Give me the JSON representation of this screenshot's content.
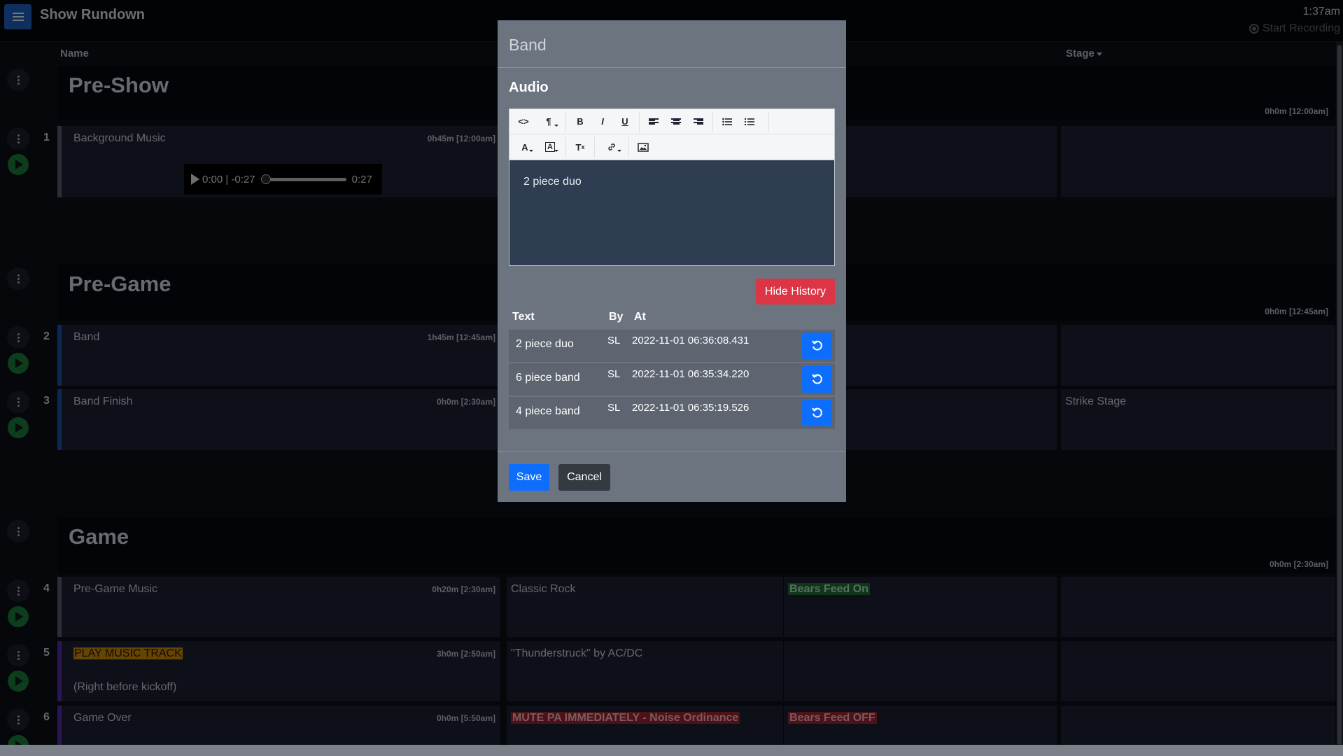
{
  "app": {
    "title": "Show Rundown",
    "clock": "1:37am",
    "recording": "Start Recording"
  },
  "columns": {
    "name": "Name",
    "stage": "Stage"
  },
  "sections": [
    {
      "title": "Pre-Show",
      "time": "0h0m  [12:00am]"
    },
    {
      "title": "Pre-Game",
      "time": "0h0m  [12:45am]"
    },
    {
      "title": "Game",
      "time": "0h0m  [2:30am]"
    }
  ],
  "rows": [
    {
      "num": "1",
      "name": "Background Music",
      "dur": "0h45m  [12:00am]"
    },
    {
      "num": "2",
      "name": "Band",
      "dur": "1h45m  [12:45am]"
    },
    {
      "num": "3",
      "name": "Band Finish",
      "dur": "0h0m  [2:30am]",
      "stage": "Strike Stage"
    },
    {
      "num": "4",
      "name": "Pre-Game Music",
      "dur": "0h20m  [2:30am]",
      "audio": "Classic Rock",
      "video": "Bears Feed On"
    },
    {
      "num": "5",
      "name": "PLAY MUSIC TRACK",
      "note": "(Right before kickoff)",
      "dur": "3h0m  [2:50am]",
      "audio": "\"Thunderstruck\" by AC/DC"
    },
    {
      "num": "6",
      "name": "Game Over",
      "dur": "0h0m  [5:50am]",
      "audio": "MUTE PA IMMEDIATELY - Noise Ordinance",
      "video": "Bears Feed OFF"
    }
  ],
  "player": {
    "current": "0:00",
    "remaining": "-0:27",
    "total": "0:27",
    "progress": 0
  },
  "modal": {
    "title": "Band",
    "field_label": "Audio",
    "editor_value": "2 piece duo",
    "hide_history": "Hide History",
    "history_headers": {
      "text": "Text",
      "by": "By",
      "at": "At"
    },
    "history": [
      {
        "text": "2 piece duo",
        "by": "SL",
        "at": "2022-11-01 06:36:08.431"
      },
      {
        "text": "6 piece band",
        "by": "SL",
        "at": "2022-11-01 06:35:34.220"
      },
      {
        "text": "4 piece band",
        "by": "SL",
        "at": "2022-11-01 06:35:19.526"
      }
    ],
    "save": "Save",
    "cancel": "Cancel"
  },
  "toolbar_icons": [
    "code-view-icon",
    "paragraph-icon",
    "bold-icon",
    "italic-icon",
    "underline-icon",
    "align-left-icon",
    "align-center-icon",
    "align-right-icon",
    "bullet-list-icon",
    "numbered-list-icon",
    "font-color-icon",
    "highlight-color-icon",
    "clear-format-icon",
    "link-icon",
    "image-icon"
  ],
  "colors": {
    "accent": "#0d6efd",
    "danger": "#dc3545",
    "play": "#1d7a3a",
    "highlight_yellow": "#c98a0a",
    "highlight_green": "#1e6b36",
    "highlight_red": "#9a2330"
  }
}
